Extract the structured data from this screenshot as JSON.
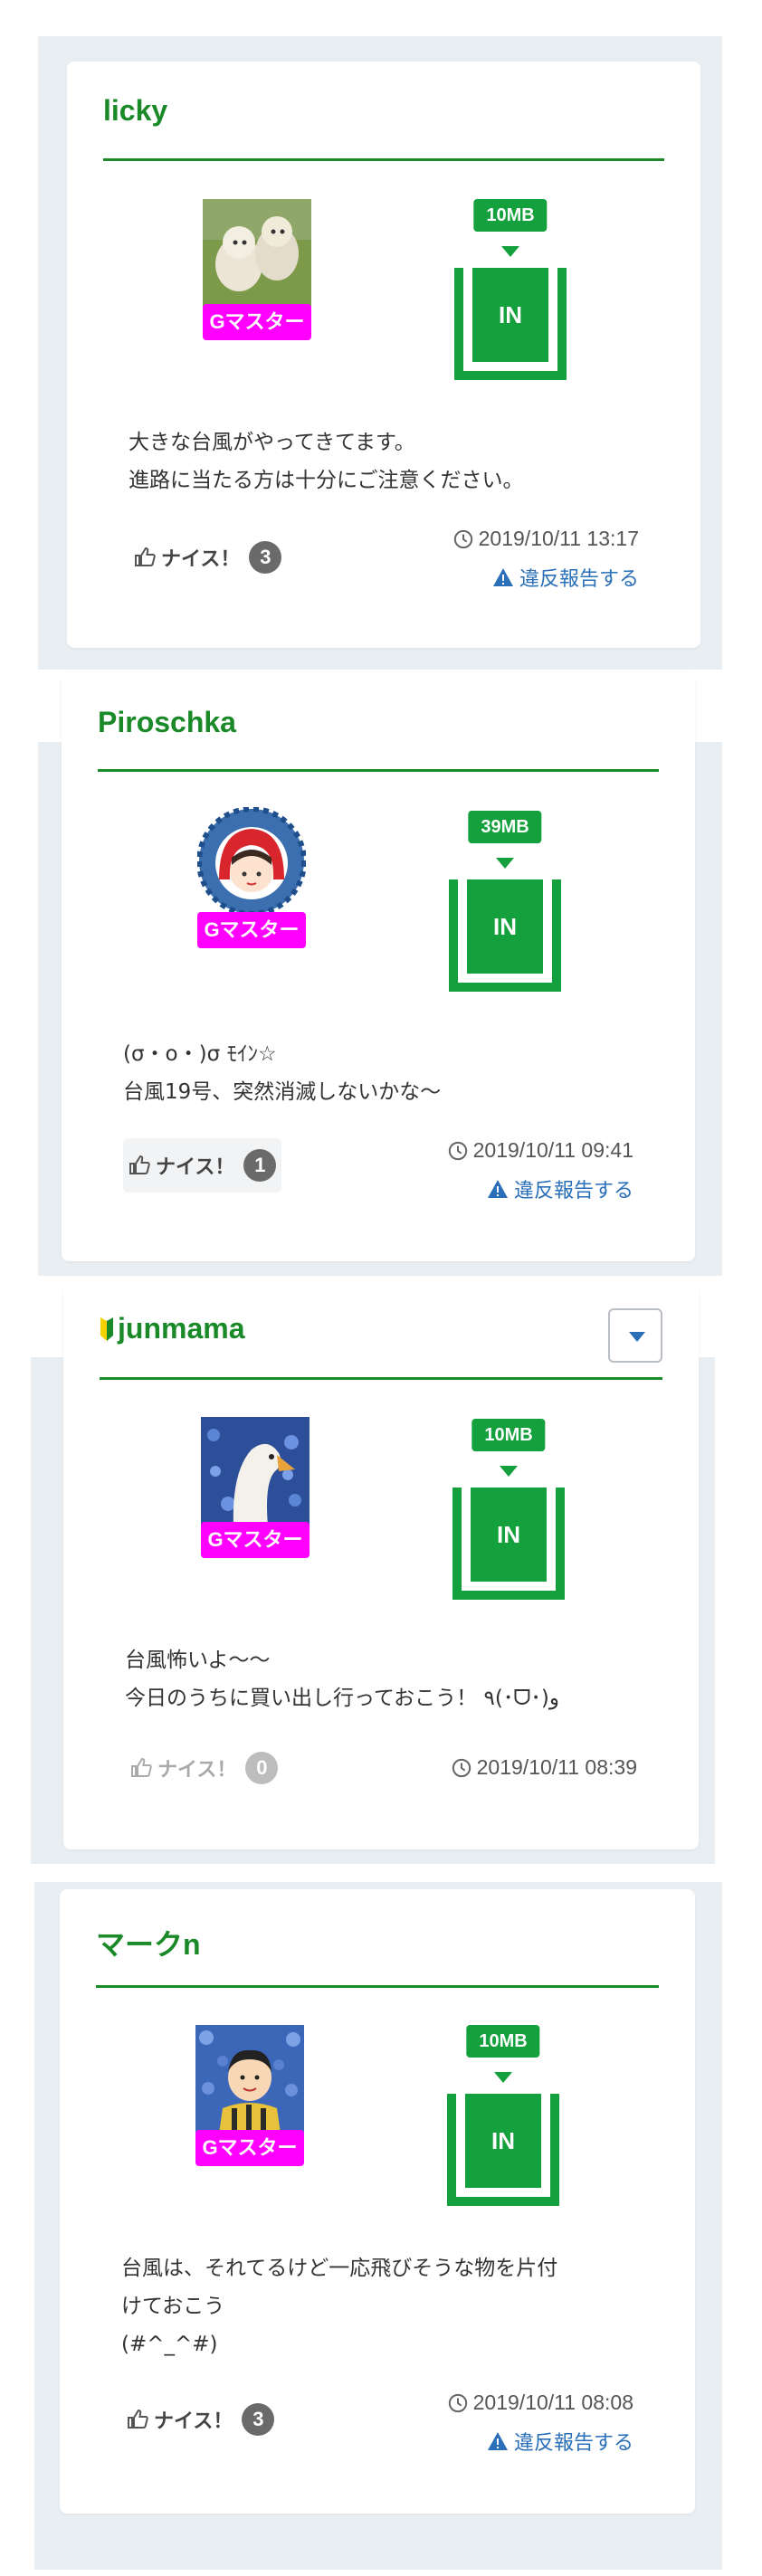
{
  "colors": {
    "accent_green": "#1a8a28",
    "data_green": "#14a03c",
    "badge_magenta": "#ff00ff",
    "link_blue": "#2a6fb8",
    "background": "#e9eef3"
  },
  "posts": [
    {
      "username": "licky",
      "badge": "Gマスター",
      "data_amount": "10MB",
      "data_label": "IN",
      "comment": "大きな台風がやってきてます。\n進路に当たる方は十分にご注意ください。",
      "nice_label": "ナイス！",
      "nice_count": "3",
      "timestamp": "2019/10/11 13:17",
      "report_label": "違反報告する",
      "avatar_icon": "dogs-photo"
    },
    {
      "username": "Piroschka",
      "badge": "Gマスター",
      "data_amount": "39MB",
      "data_label": "IN",
      "comment": "(σ・o・)σ ﾓｲﾝ☆\n台風19号、突然消滅しないかな〜",
      "nice_label": "ナイス！",
      "nice_count": "1",
      "timestamp": "2019/10/11 09:41",
      "report_label": "違反報告する",
      "avatar_icon": "red-hood-girl-avatar"
    },
    {
      "username": "junmama",
      "badge": "Gマスター",
      "data_amount": "10MB",
      "data_label": "IN",
      "comment": "台風怖いよ〜〜\n今日のうちに買い出し行っておこう！ ٩(･ᗜ･)و",
      "nice_label": "ナイス！",
      "nice_count": "0",
      "timestamp": "2019/10/11 08:39",
      "avatar_icon": "goose-photo",
      "beginner_icon": "beginner-mark-icon"
    },
    {
      "username": "マークn",
      "badge": "Gマスター",
      "data_amount": "10MB",
      "data_label": "IN",
      "comment": "台風は、それてるけど一応飛びそうな物を片付\nけておこう\n(#^_^#)",
      "nice_label": "ナイス！",
      "nice_count": "3",
      "timestamp": "2019/10/11 08:08",
      "report_label": "違反報告する",
      "avatar_icon": "boy-flowers-avatar"
    }
  ]
}
